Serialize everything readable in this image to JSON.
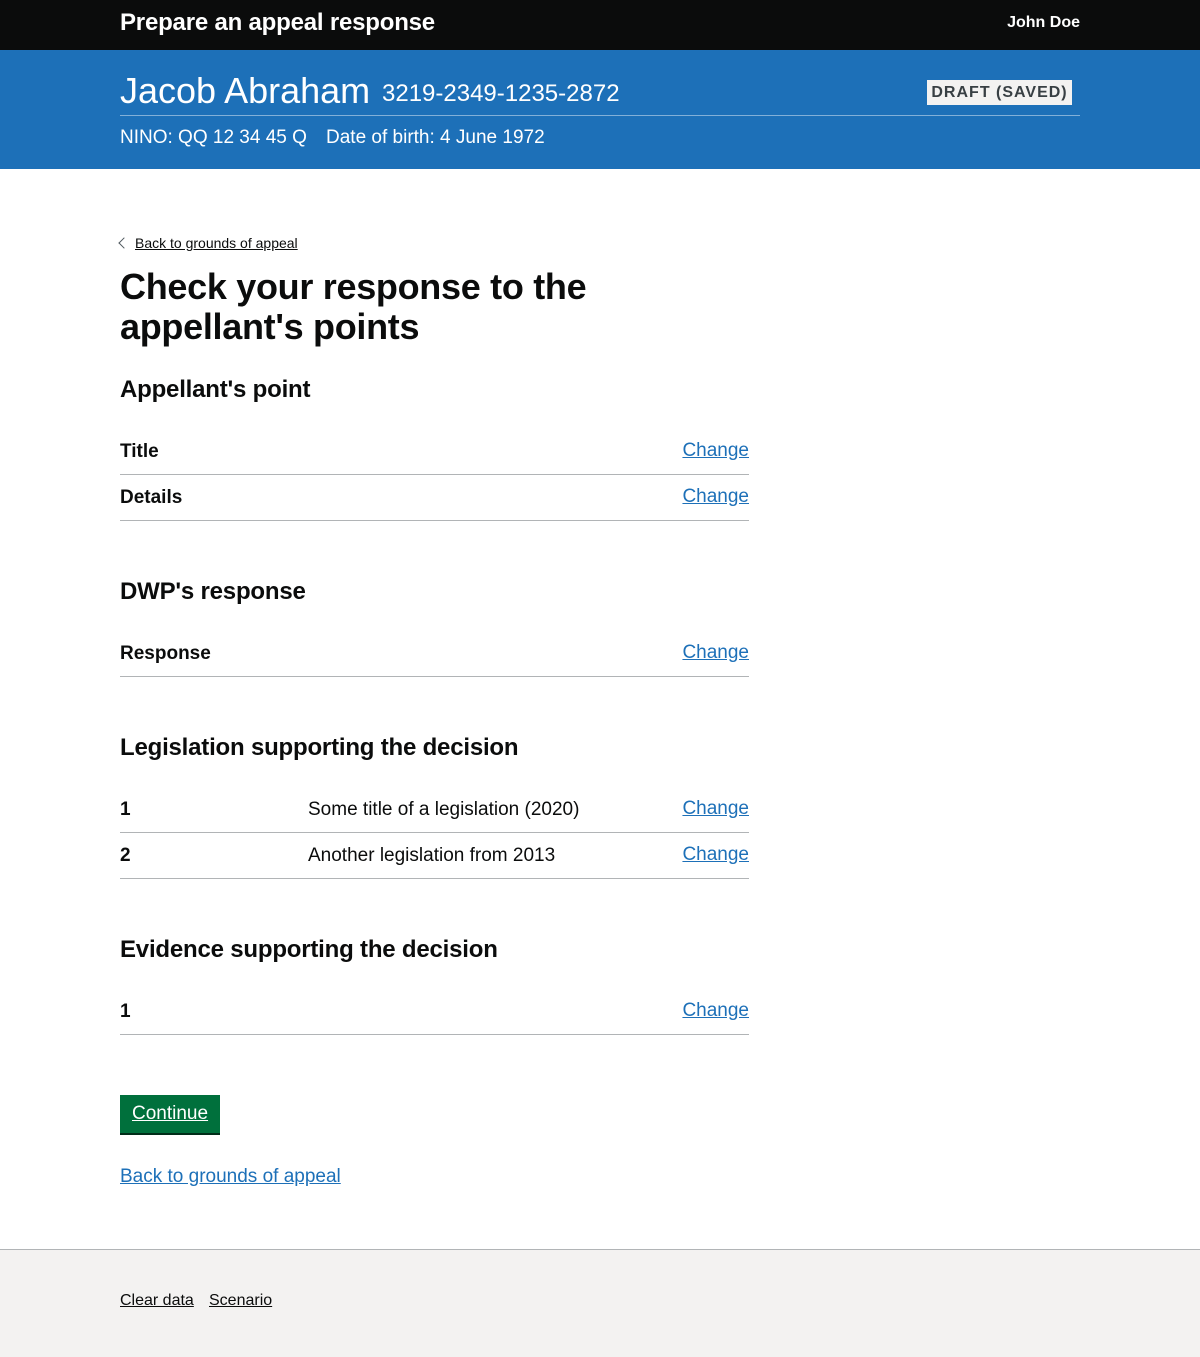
{
  "header": {
    "service_name": "Prepare an appeal response",
    "user_name": "John Doe"
  },
  "banner": {
    "name": "Jacob Abraham",
    "reference": "3219-2349-1235-2872",
    "status": "DRAFT (SAVED)",
    "nino": "NINO: QQ 12 34 45 Q",
    "dob": "Date of birth: 4 June 1972"
  },
  "main": {
    "back_link": "Back to grounds of appeal",
    "title": "Check your response to the appellant's points",
    "sections": {
      "appellant": {
        "heading": "Appellant's point",
        "rows": [
          {
            "key": "Title",
            "value": "",
            "action": "Change"
          },
          {
            "key": "Details",
            "value": "",
            "action": "Change"
          }
        ]
      },
      "dwp": {
        "heading": "DWP's response",
        "rows": [
          {
            "key": "Response",
            "value": "",
            "action": "Change"
          }
        ]
      },
      "legislation": {
        "heading": "Legislation supporting the decision",
        "rows": [
          {
            "key": "1",
            "value": "Some title of a legislation (2020)",
            "action": "Change"
          },
          {
            "key": "2",
            "value": "Another legislation from 2013",
            "action": "Change"
          }
        ]
      },
      "evidence": {
        "heading": "Evidence supporting the decision",
        "rows": [
          {
            "key": "1",
            "value": "",
            "action": "Change"
          }
        ]
      }
    },
    "continue_label": "Continue",
    "back_bottom": "Back to grounds of appeal"
  },
  "footer": {
    "links": [
      "Clear data",
      "Scenario"
    ]
  },
  "colors": {
    "header_bg": "#0b0c0c",
    "banner_bg": "#1d70b8",
    "link": "#1d70b8",
    "button": "#00703c",
    "footer_bg": "#f3f2f1"
  }
}
